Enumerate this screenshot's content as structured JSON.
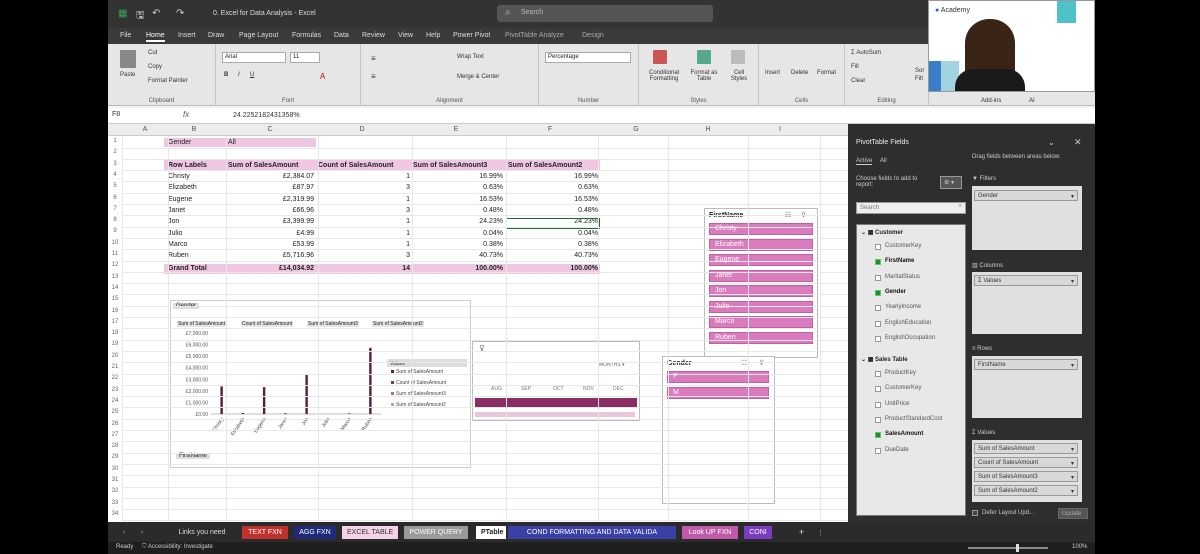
{
  "window": {
    "title": "0. Excel for Data Analysis - Excel",
    "search_placeholder": "Search"
  },
  "menu": [
    "File",
    "Home",
    "Insert",
    "Draw",
    "Page Layout",
    "Formulas",
    "Data",
    "Review",
    "View",
    "Help",
    "Power Pivot",
    "PivotTable Analyze",
    "Design"
  ],
  "ribbon": {
    "clipboard": {
      "paste": "Paste",
      "cut": "Cut",
      "copy": "Copy",
      "format_painter": "Format Painter",
      "label": "Clipboard"
    },
    "font": {
      "name": "Arial",
      "size": "11",
      "label": "Font"
    },
    "alignment": {
      "wrap": "Wrap Text",
      "merge": "Merge & Center",
      "label": "Alignment"
    },
    "number": {
      "format": "Percentage",
      "label": "Number"
    },
    "styles": {
      "conditional": "Conditional Formatting",
      "format_table": "Format as Table",
      "cell_styles": "Cell Styles",
      "label": "Styles"
    },
    "cells": {
      "insert": "Insert",
      "delete": "Delete",
      "format": "Format",
      "label": "Cells"
    },
    "editing": {
      "autosum": "AutoSum",
      "fill": "Fill",
      "clear": "Clear",
      "label": "Editing",
      "sort": "Sor",
      "filter": "Filt"
    },
    "addins": {
      "label": "Add-ins",
      "ai": "AI"
    }
  },
  "formula_bar": {
    "name_box": "F8",
    "formula": "24.2252182431358%"
  },
  "columns": [
    "A",
    "B",
    "C",
    "D",
    "E",
    "F",
    "G",
    "H",
    "I"
  ],
  "rows": [
    "1",
    "2",
    "3",
    "4",
    "5",
    "6",
    "7",
    "8",
    "9",
    "10",
    "11",
    "12",
    "13",
    "14",
    "15",
    "16",
    "17",
    "18",
    "19",
    "20",
    "21",
    "22",
    "23",
    "24",
    "25",
    "26",
    "27",
    "28",
    "29",
    "30",
    "31",
    "32",
    "33",
    "34"
  ],
  "pivot": {
    "filter_label": "Gender",
    "filter_value": "All",
    "headers": [
      "Row Labels",
      "Sum of SalesAmount",
      "Count of SalesAmount",
      "Sum of SalesAmount3",
      "Sum of SalesAmount2"
    ],
    "rows": [
      [
        "Christy",
        "£2,384.07",
        "1",
        "16.99%",
        "16.99%"
      ],
      [
        "Elizabeth",
        "£87.97",
        "3",
        "0.63%",
        "0.63%"
      ],
      [
        "Eugene",
        "£2,319.99",
        "1",
        "16.53%",
        "16.53%"
      ],
      [
        "Janet",
        "£66.96",
        "3",
        "0.48%",
        "0.48%"
      ],
      [
        "Jon",
        "£3,399.99",
        "1",
        "24.23%",
        "24.23%"
      ],
      [
        "Julio",
        "£4.99",
        "1",
        "0.04%",
        "0.04%"
      ],
      [
        "Marco",
        "£53.99",
        "1",
        "0.38%",
        "0.38%"
      ],
      [
        "Ruben",
        "£5,716.96",
        "3",
        "40.73%",
        "40.73%"
      ]
    ],
    "total": [
      "Grand Total",
      "£14,034.92",
      "14",
      "100.00%",
      "100.00%"
    ]
  },
  "chart_data": {
    "type": "bar",
    "categories": [
      "Christy",
      "Elizabeth",
      "Eugene",
      "Janet",
      "Jon",
      "Julio",
      "Marco",
      "Ruben"
    ],
    "series": [
      {
        "name": "Sum of SalesAmount",
        "values": [
          2384.07,
          87.97,
          2319.99,
          66.96,
          3399.99,
          4.99,
          53.99,
          5716.96
        ]
      },
      {
        "name": "Count of SalesAmount",
        "values": [
          1,
          3,
          1,
          3,
          1,
          1,
          1,
          3
        ]
      },
      {
        "name": "Sum of SalesAmount3",
        "values": [
          0.1699,
          0.0063,
          0.1653,
          0.0048,
          0.2423,
          0.0004,
          0.0038,
          0.4073
        ]
      },
      {
        "name": "Sum of SalesAmount2",
        "values": [
          0.1699,
          0.0063,
          0.1653,
          0.0048,
          0.2423,
          0.0004,
          0.0038,
          0.4073
        ]
      }
    ],
    "yticks": [
      "£7,000.00",
      "£6,000.00",
      "£5,000.00",
      "£4,000.00",
      "£3,000.00",
      "£2,000.00",
      "£1,000.00",
      "£0.00"
    ],
    "ylim": [
      0,
      7000
    ],
    "filter_button": "Gender",
    "field_buttons": [
      "Sum of SalesAmount",
      "Count of SalesAmount",
      "Sum of SalesAmount3",
      "Sum of SalesAmount2"
    ],
    "axis_button": "FirstName",
    "legend_title": "Values",
    "legend_position": "right",
    "color": "#5a1f3a"
  },
  "timeline": {
    "period": "MONTHS",
    "months": [
      "AUG",
      "SEP",
      "OCT",
      "NOV",
      "DEC"
    ]
  },
  "slicer_firstname": {
    "title": "FirstName",
    "items": [
      "Christy",
      "Elizabeth",
      "Eugene",
      "Janet",
      "Jon",
      "Julio",
      "Marco",
      "Ruben"
    ]
  },
  "slicer_gender": {
    "title": "Gender",
    "items": [
      "F",
      "M"
    ]
  },
  "pane": {
    "title": "PivotTable Fields",
    "tab_active": "Active",
    "tab_all": "All",
    "choose": "Choose fields to add to report:",
    "search": "Search",
    "drag": "Drag fields between areas below:",
    "tables": [
      {
        "name": "Customer",
        "fields": [
          {
            "n": "CustomerKey",
            "c": false
          },
          {
            "n": "FirstName",
            "c": true
          },
          {
            "n": "MaritalStatus",
            "c": false
          },
          {
            "n": "Gender",
            "c": true
          },
          {
            "n": "YearlyIncome",
            "c": false
          },
          {
            "n": "EnglishEducation",
            "c": false
          },
          {
            "n": "EnglishOccupation",
            "c": false
          }
        ]
      },
      {
        "name": "Sales Table",
        "fields": [
          {
            "n": "ProductKey",
            "c": false
          },
          {
            "n": "CustomerKey",
            "c": false
          },
          {
            "n": "UnitPrice",
            "c": false
          },
          {
            "n": "ProductStandardCost",
            "c": false
          },
          {
            "n": "SalesAmount",
            "c": true
          },
          {
            "n": "DueDate",
            "c": false
          }
        ]
      }
    ],
    "filters_label": "Filters",
    "filters": [
      "Gender"
    ],
    "columns_label": "Columns",
    "columns": [
      "Σ Values"
    ],
    "rows_label": "Rows",
    "rows": [
      "FirstName"
    ],
    "values_label": "Values",
    "values": [
      "Sum of SalesAmount",
      "Count of SalesAmount",
      "Sum of SalesAmount3",
      "Sum of SalesAmount2"
    ],
    "defer": "Defer Layout Upd...",
    "update": "Update"
  },
  "sheets": [
    {
      "name": "Links you need",
      "bg": "#2b2b2b",
      "fg": "#ddd"
    },
    {
      "name": "TEXT FXN",
      "bg": "#c0302c",
      "fg": "#fff"
    },
    {
      "name": "AGG FXN",
      "bg": "#1f2a7a",
      "fg": "#fff"
    },
    {
      "name": "EXCEL TABLE",
      "bg": "#f4d3e8",
      "fg": "#333"
    },
    {
      "name": "POWER QUERY",
      "bg": "#9a9a9a",
      "fg": "#fff"
    },
    {
      "name": "PTable",
      "bg": "#ffffff",
      "fg": "#222"
    },
    {
      "name": "COND FORMATTING AND DATA VALIDA",
      "bg": "#3a40a8",
      "fg": "#fff"
    },
    {
      "name": "Look UP FXN",
      "bg": "#c05aa8",
      "fg": "#fff"
    },
    {
      "name": "CONI",
      "bg": "#7a3cc0",
      "fg": "#fff"
    }
  ],
  "status": {
    "ready": "Ready",
    "accessibility": "Accessibility: Investigate",
    "zoom": "100%"
  },
  "webcam": {
    "label": "Academy"
  }
}
